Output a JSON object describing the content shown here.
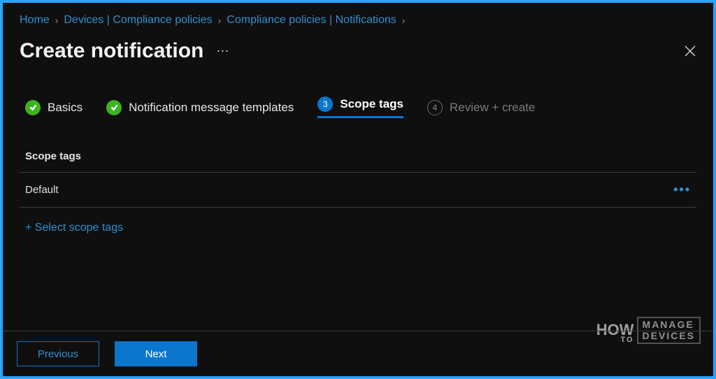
{
  "breadcrumb": {
    "home": "Home",
    "devices": "Devices | Compliance policies",
    "notifications": "Compliance policies | Notifications"
  },
  "header": {
    "title": "Create notification"
  },
  "stepper": {
    "basics": {
      "label": "Basics"
    },
    "templates": {
      "label": "Notification message templates"
    },
    "scope": {
      "num": "3",
      "label": "Scope tags"
    },
    "review": {
      "num": "4",
      "label": "Review + create"
    }
  },
  "section": {
    "title": "Scope tags",
    "rows": [
      {
        "label": "Default"
      }
    ],
    "select_link": "+ Select scope tags"
  },
  "footer": {
    "previous": "Previous",
    "next": "Next"
  },
  "watermark": {
    "how": "HOW",
    "to": "TO",
    "line1": "MANAGE",
    "line2": "DEVICES"
  }
}
